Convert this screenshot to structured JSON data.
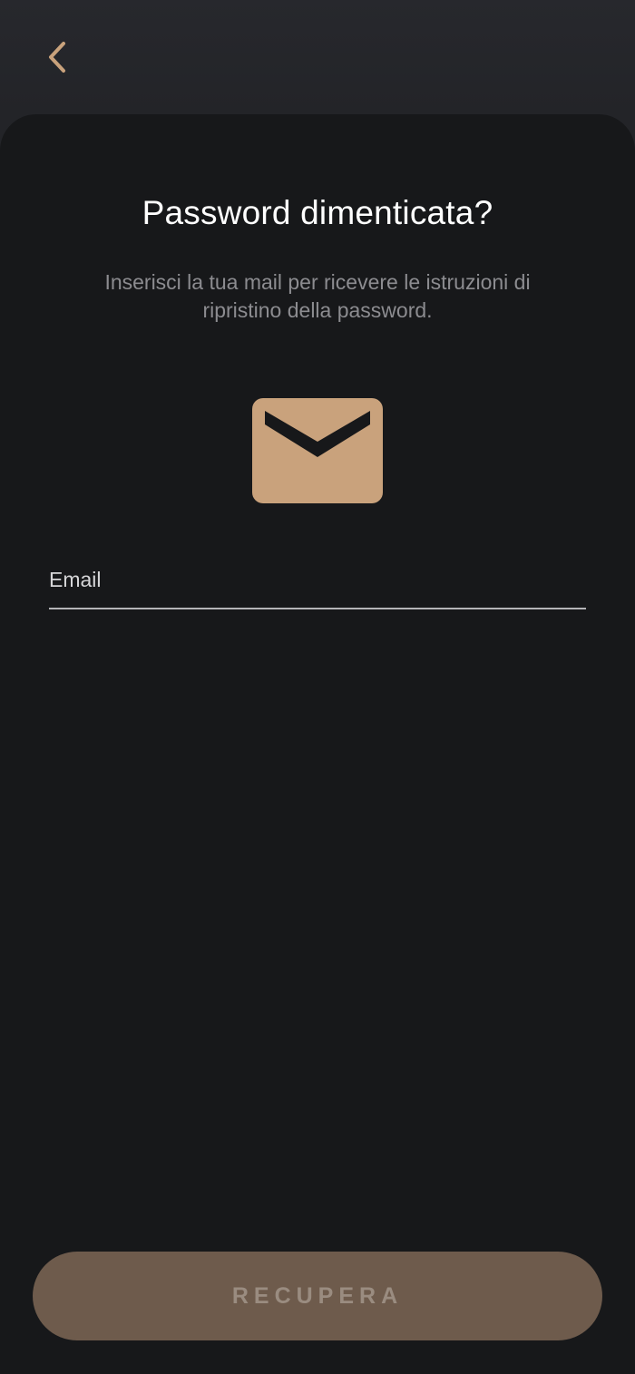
{
  "header": {
    "back_icon": "chevron-left-icon"
  },
  "screen": {
    "title": "Password dimenticata?",
    "subtitle": "Inserisci la tua mail per ricevere le istruzioni di ripristino della password.",
    "illustration_icon": "envelope-icon"
  },
  "form": {
    "email_placeholder": "Email",
    "email_value": ""
  },
  "actions": {
    "recover_label": "RECUPERA"
  },
  "colors": {
    "accent": "#c9a27c",
    "background": "#17181a",
    "header_background": "#25262a",
    "button_disabled": "#6e5b4c"
  }
}
